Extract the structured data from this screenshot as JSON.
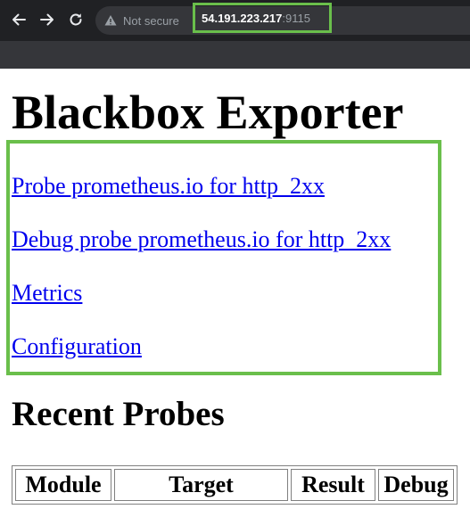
{
  "browser": {
    "security_label": "Not secure",
    "url_host": "54.191.223.217",
    "url_port": ":9115",
    "highlight_color": "#6abf4b"
  },
  "icons": {
    "back": "back-arrow-icon",
    "forward": "forward-arrow-icon",
    "reload": "reload-icon",
    "security": "warning-triangle-icon"
  },
  "page": {
    "title": "Blackbox Exporter",
    "links": [
      "Probe prometheus.io for http_2xx",
      "Debug probe prometheus.io for http_2xx",
      "Metrics",
      "Configuration"
    ],
    "recent_title": "Recent Probes",
    "table_headers": [
      "Module",
      "Target",
      "Result",
      "Debug"
    ],
    "link_color": "#0000ee"
  }
}
